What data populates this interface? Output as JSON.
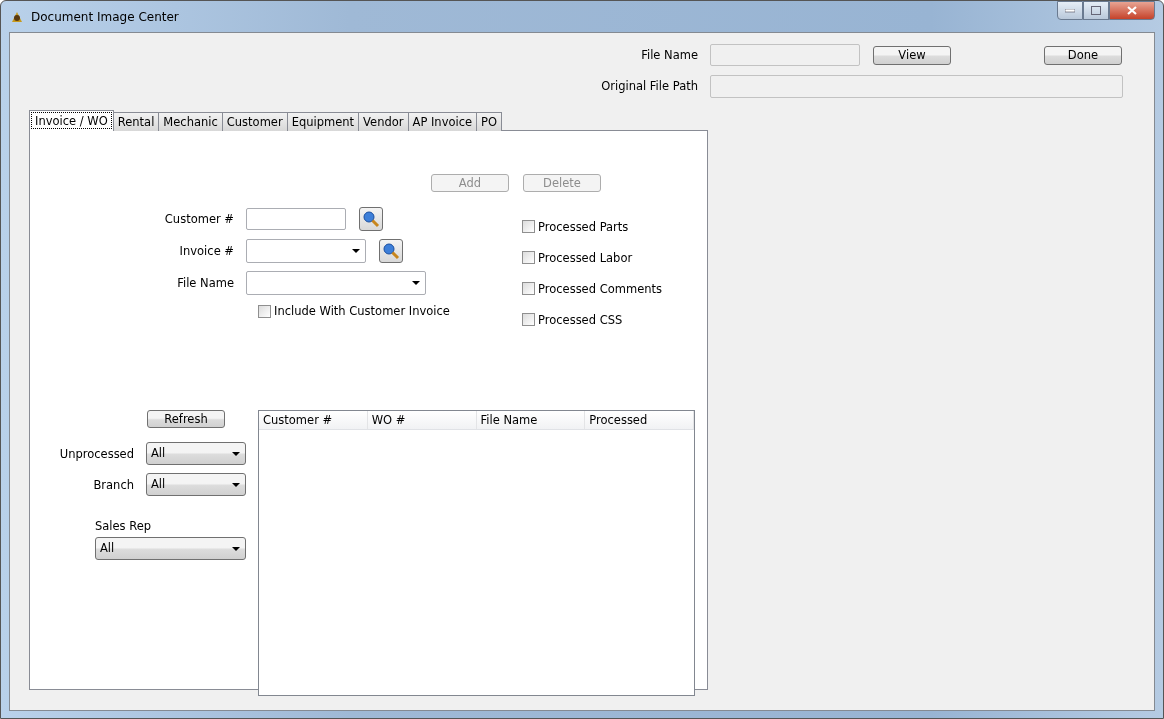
{
  "window": {
    "title": "Document Image Center"
  },
  "header": {
    "file_name_label": "File Name",
    "view_button": "View",
    "done_button": "Done",
    "original_path_label": "Original File Path"
  },
  "tabs": [
    {
      "label": "Invoice / WO",
      "selected": true
    },
    {
      "label": "Rental",
      "selected": false
    },
    {
      "label": "Mechanic",
      "selected": false
    },
    {
      "label": "Customer",
      "selected": false
    },
    {
      "label": "Equipment",
      "selected": false
    },
    {
      "label": "Vendor",
      "selected": false
    },
    {
      "label": "AP Invoice",
      "selected": false
    },
    {
      "label": "PO",
      "selected": false
    }
  ],
  "actions": [
    {
      "label": "Add",
      "disabled": true
    },
    {
      "label": "Delete",
      "disabled": true
    }
  ],
  "form": {
    "customer_label": "Customer #",
    "invoice_label": "Invoice #",
    "file_name_label": "File Name",
    "include": {
      "label": "Include With Customer Invoice",
      "checked": false
    }
  },
  "processed": [
    {
      "label": "Processed Parts",
      "checked": false
    },
    {
      "label": "Processed Labor",
      "checked": false
    },
    {
      "label": "Processed Comments",
      "checked": false
    },
    {
      "label": "Processed CSS",
      "checked": false
    }
  ],
  "filters": {
    "refresh_button": "Refresh",
    "unprocessed_label": "Unprocessed",
    "unprocessed_value": "All",
    "branch_label": "Branch",
    "branch_value": "All",
    "sales_rep_label": "Sales Rep",
    "sales_rep_value": "All"
  },
  "table": {
    "columns": [
      "Customer #",
      "WO #",
      "File Name",
      "Processed"
    ]
  }
}
